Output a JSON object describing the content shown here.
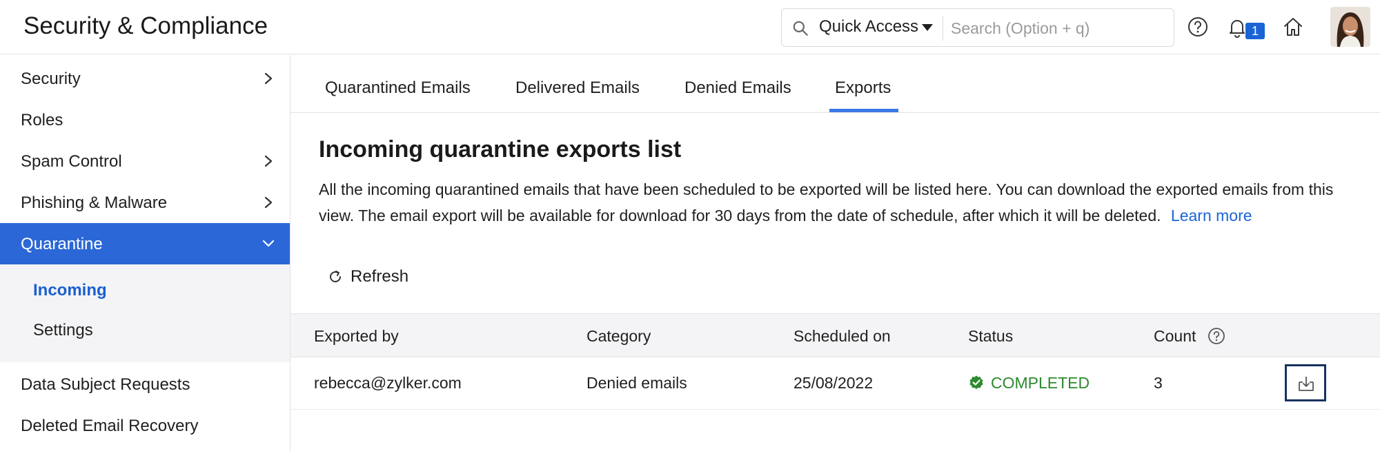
{
  "header": {
    "app_title": "Security & Compliance",
    "quick_access_label": "Quick Access",
    "search_placeholder": "Search (Option + q)",
    "notification_count": "1",
    "icons": [
      "search-icon",
      "caret-down-icon",
      "help-icon",
      "bell-icon",
      "home-icon",
      "user-avatar"
    ]
  },
  "sidebar": {
    "items": [
      {
        "label": "Security",
        "has_chevron": true
      },
      {
        "label": "Roles",
        "has_chevron": false
      },
      {
        "label": "Spam Control",
        "has_chevron": true
      },
      {
        "label": "Phishing & Malware",
        "has_chevron": true
      },
      {
        "label": "Quarantine",
        "has_chevron": true,
        "expanded": true,
        "active": true
      },
      {
        "label": "Data Subject Requests",
        "has_chevron": false
      },
      {
        "label": "Deleted Email Recovery",
        "has_chevron": false
      }
    ],
    "quarantine_subitems": [
      {
        "label": "Incoming",
        "active": true
      },
      {
        "label": "Settings",
        "active": false
      }
    ]
  },
  "tabs": [
    {
      "label": "Quarantined Emails",
      "active": false
    },
    {
      "label": "Delivered Emails",
      "active": false
    },
    {
      "label": "Denied Emails",
      "active": false
    },
    {
      "label": "Exports",
      "active": true
    }
  ],
  "main": {
    "title": "Incoming quarantine exports list",
    "description": "All the incoming quarantined emails that have been scheduled to be exported will be listed here. You can download the exported emails from this view. The email export will be available for download for 30 days from the date of schedule, after which it will be deleted.",
    "learn_more": "Learn more",
    "refresh_label": "Refresh"
  },
  "table": {
    "columns": [
      "Exported by",
      "Category",
      "Scheduled on",
      "Status",
      "Count"
    ],
    "rows": [
      {
        "exported_by": "rebecca@zylker.com",
        "category": "Denied emails",
        "scheduled_on": "25/08/2022",
        "status": "COMPLETED",
        "count": "3"
      }
    ]
  },
  "colors": {
    "accent": "#2b67d6",
    "link": "#1a64d6",
    "status_completed": "#2c8a2f",
    "badge": "#1a64d6"
  }
}
